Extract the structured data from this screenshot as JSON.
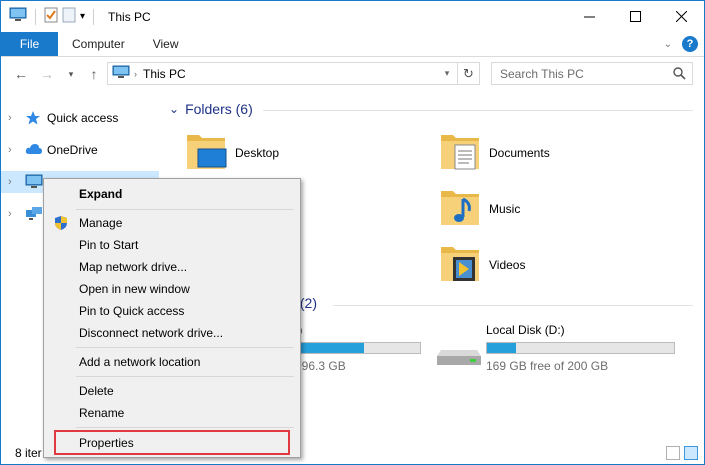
{
  "window": {
    "title": "This PC",
    "accent": "#1979ca"
  },
  "ribbon": {
    "tabs": [
      {
        "label": "File"
      },
      {
        "label": "Computer"
      },
      {
        "label": "View"
      }
    ]
  },
  "address": {
    "path": "This PC",
    "search_placeholder": "Search This PC"
  },
  "nav": {
    "items": [
      {
        "label": "Quick access",
        "icon": "star-icon"
      },
      {
        "label": "OneDrive",
        "icon": "cloud-icon"
      },
      {
        "label": "",
        "icon": "computer-icon"
      },
      {
        "label": "",
        "icon": "network-icon"
      }
    ]
  },
  "content": {
    "folders_header": "Folders (6)",
    "folders": [
      {
        "label": "Desktop",
        "icon": "desktop-folder-icon"
      },
      {
        "label": "Documents",
        "icon": "documents-folder-icon"
      },
      {
        "label": "Music",
        "icon": "music-folder-icon"
      },
      {
        "label": "Videos",
        "icon": "videos-folder-icon"
      }
    ],
    "drives_header": "s (2)",
    "drives": [
      {
        "name": ":)",
        "free": "f 96.3 GB",
        "used_fraction": 0.55
      },
      {
        "name": "Local Disk (D:)",
        "free": "169 GB free of 200 GB",
        "used_fraction": 0.155
      }
    ]
  },
  "status": {
    "count": "8 iter"
  },
  "context_menu": {
    "items": [
      {
        "label": "Expand",
        "bold": true
      },
      {
        "label": "Manage",
        "icon": "shield-icon"
      },
      {
        "label": "Pin to Start"
      },
      {
        "label": "Map network drive..."
      },
      {
        "label": "Open in new window"
      },
      {
        "label": "Pin to Quick access"
      },
      {
        "label": "Disconnect network drive..."
      },
      {
        "label": "Add a network location"
      },
      {
        "label": "Delete"
      },
      {
        "label": "Rename"
      },
      {
        "label": "Properties",
        "highlighted": true
      }
    ]
  }
}
